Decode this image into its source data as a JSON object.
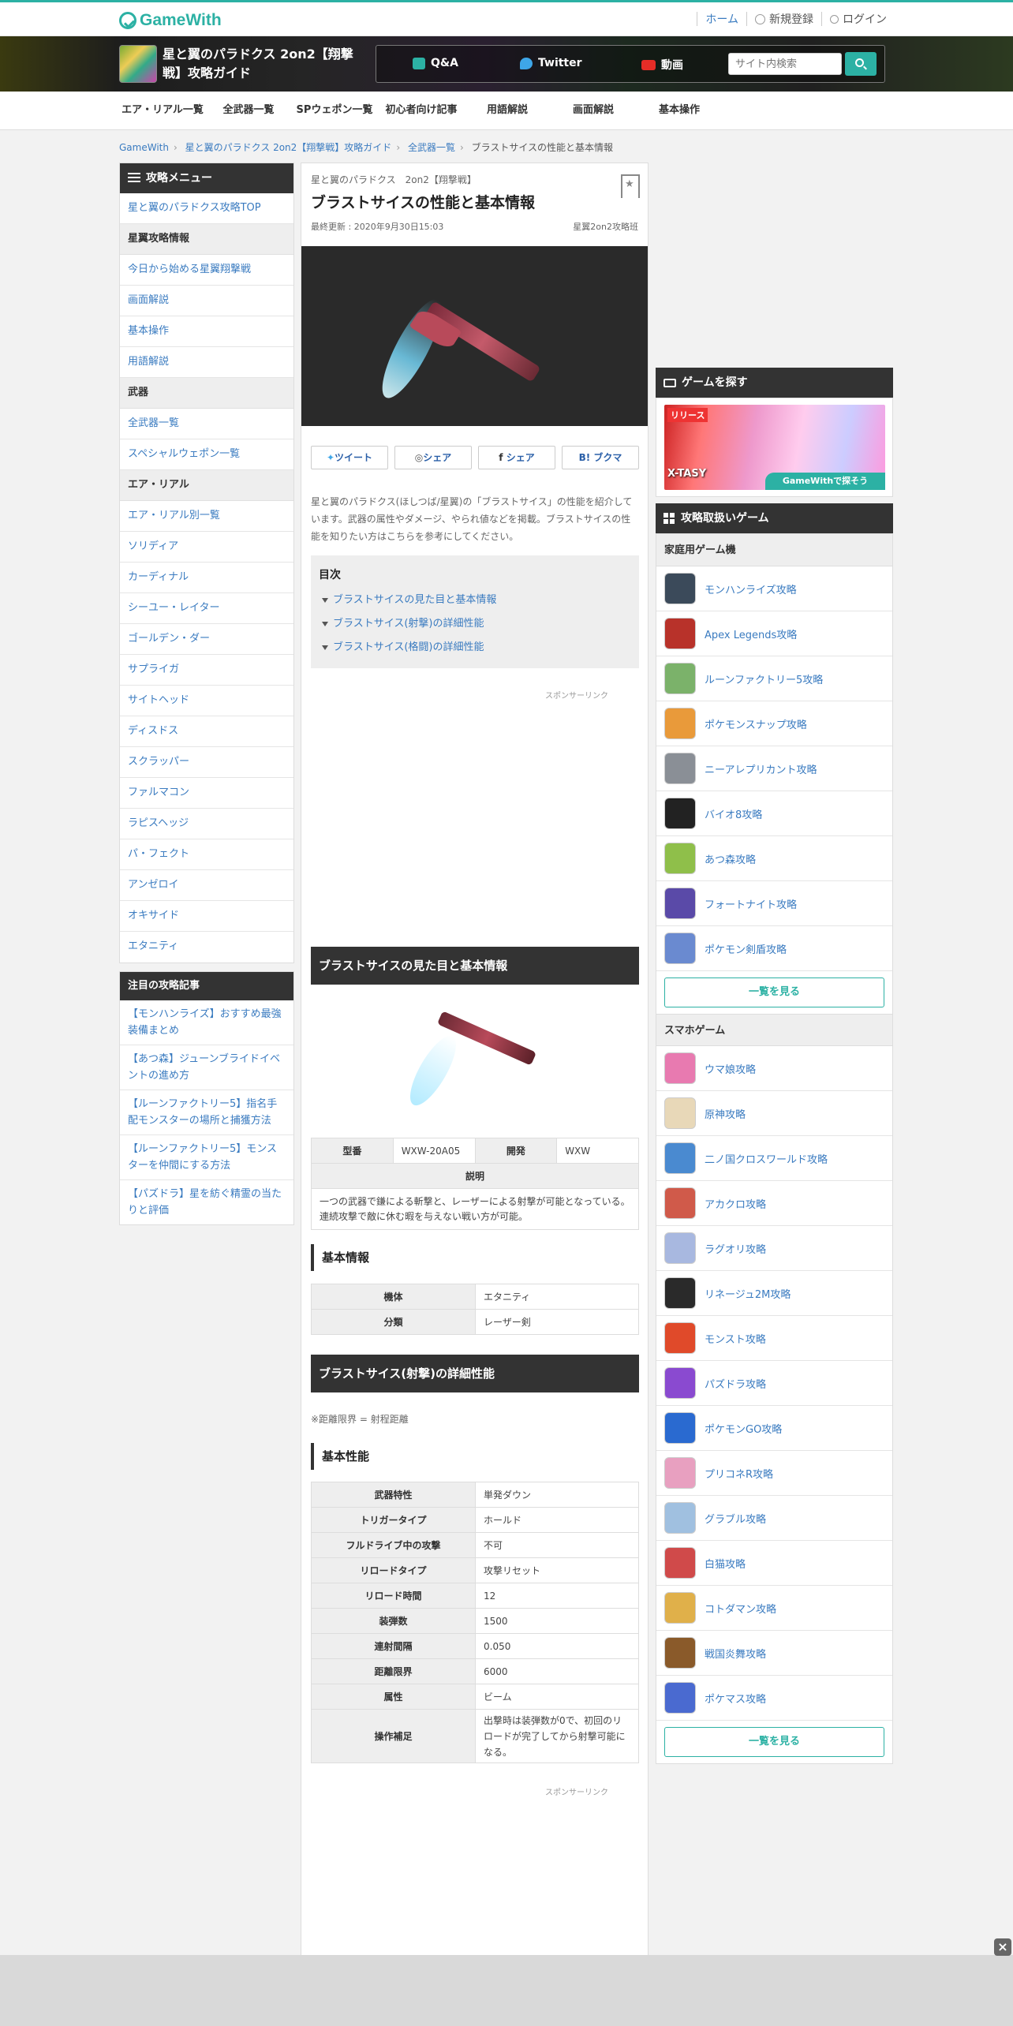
{
  "site": {
    "logo": "GameWith"
  },
  "topnav": {
    "home": "ホーム",
    "register": "新規登録",
    "login": "ログイン"
  },
  "header": {
    "title": "星と翼のパラドクス 2on2【翔撃戦】攻略ガイド",
    "qa": "Q&A",
    "twitter": "Twitter",
    "video": "動画",
    "search_placeholder": "サイト内検索"
  },
  "gnav": [
    "エア・リアル一覧",
    "全武器一覧",
    "SPウェポン一覧",
    "初心者向け記事",
    "用語解説",
    "画面解説",
    "基本操作"
  ],
  "breadcrumb": [
    "GameWith",
    "星と翼のパラドクス 2on2【翔撃戦】攻略ガイド",
    "全武器一覧",
    "ブラストサイスの性能と基本情報"
  ],
  "left_sidebar": {
    "menu_title": "攻略メニュー",
    "top_link": "星と翼のパラドクス攻略TOP",
    "sections": [
      {
        "title": "星翼攻略情報",
        "items": [
          "今日から始める星翼翔撃戦",
          "画面解説",
          "基本操作",
          "用語解説"
        ]
      },
      {
        "title": "武器",
        "items": [
          "全武器一覧",
          "スペシャルウェポン一覧"
        ]
      },
      {
        "title": "エア・リアル",
        "items": [
          "エア・リアル別一覧",
          "ソリディア",
          "カーディナル",
          "シーユー・レイター",
          "ゴールデン・ダー",
          "サプライガ",
          "サイトヘッド",
          "ディスドス",
          "スクラッパー",
          "ファルマコン",
          "ラピスヘッジ",
          "パ・フェクト",
          "アンゼロイ",
          "オキサイド",
          "エタニティ"
        ]
      }
    ],
    "featured_title": "注目の攻略記事",
    "featured": [
      "【モンハンライズ】おすすめ最強装備まとめ",
      "【あつ森】ジューンブライドイベントの進め方",
      "【ルーンファクトリー5】指名手配モンスターの場所と捕獲方法",
      "【ルーンファクトリー5】モンスターを仲間にする方法",
      "【パズドラ】星を紡ぐ精霊の当たりと評価"
    ]
  },
  "article": {
    "game_label": "星と翼のパラドクス　2on2【翔撃戦】",
    "title": "ブラストサイスの性能と基本情報",
    "updated": "最終更新 : 2020年9月30日15:03",
    "author": "星翼2on2攻略班",
    "share": {
      "tweet": "ツイート",
      "line": "シェア",
      "facebook": "シェア",
      "hatena": "ブクマ"
    },
    "intro": "星と翼のパラドクス(ほしつば/星翼)の「ブラストサイス」の性能を紹介しています。武器の属性やダメージ、やられ値などを掲載。ブラストサイスの性能を知りたい方はこちらを参考にしてください。",
    "toc_title": "目次",
    "toc": [
      "ブラストサイスの見た目と基本情報",
      "ブラストサイス(射撃)の詳細性能",
      "ブラストサイス(格闘)の詳細性能"
    ],
    "sponsor": "スポンサーリンク",
    "sec1": "ブラストサイスの見た目と基本情報",
    "spec": {
      "model_label": "型番",
      "model": "WXW-20A05",
      "dev_label": "開発",
      "dev": "WXW",
      "desc_label": "説明",
      "desc": "一つの武器で鎌による斬撃と、レーザーによる射撃が可能となっている。連続攻撃で敵に休む暇を与えない戦い方が可能。"
    },
    "basic_title": "基本情報",
    "basic": [
      {
        "k": "機体",
        "v": "エタニティ"
      },
      {
        "k": "分類",
        "v": "レーザー剣"
      }
    ],
    "sec2": "ブラストサイス(射撃)の詳細性能",
    "note": "※距離限界 = 射程距離",
    "perf_title": "基本性能",
    "perf": [
      {
        "k": "武器特性",
        "v": "単発ダウン"
      },
      {
        "k": "トリガータイプ",
        "v": "ホールド"
      },
      {
        "k": "フルドライブ中の攻撃",
        "v": "不可"
      },
      {
        "k": "リロードタイプ",
        "v": "攻撃リセット"
      },
      {
        "k": "リロード時間",
        "v": "12"
      },
      {
        "k": "装弾数",
        "v": "1500"
      },
      {
        "k": "連射間隔",
        "v": "0.050"
      },
      {
        "k": "距離限界",
        "v": "6000"
      },
      {
        "k": "属性",
        "v": "ビーム"
      },
      {
        "k": "操作補足",
        "v": "出撃時は装弾数が0で、初回のリロードが完了してから射撃可能になる。"
      }
    ]
  },
  "right_sidebar": {
    "find_title": "ゲームを探す",
    "promo_tag": "リリース",
    "promo_title": "X-TASY",
    "promo_badge": "GameWithで探そう",
    "games_title": "攻略取扱いゲーム",
    "console_title": "家庭用ゲーム機",
    "console": [
      {
        "name": "モンハンライズ攻略",
        "color": "#3b4a5a"
      },
      {
        "name": "Apex Legends攻略",
        "color": "#b8322a"
      },
      {
        "name": "ルーンファクトリー5攻略",
        "color": "#7bb26a"
      },
      {
        "name": "ポケモンスナップ攻略",
        "color": "#e99a3a"
      },
      {
        "name": "ニーアレプリカント攻略",
        "color": "#8a8f96"
      },
      {
        "name": "バイオ8攻略",
        "color": "#222222"
      },
      {
        "name": "あつ森攻略",
        "color": "#8fbf4a"
      },
      {
        "name": "フォートナイト攻略",
        "color": "#5a4aa8"
      },
      {
        "name": "ポケモン剣盾攻略",
        "color": "#6a8ad0"
      }
    ],
    "more": "一覧を見る",
    "mobile_title": "スマホゲーム",
    "mobile": [
      {
        "name": "ウマ娘攻略",
        "color": "#e87ab0"
      },
      {
        "name": "原神攻略",
        "color": "#e8d8b8"
      },
      {
        "name": "二ノ国クロスワールド攻略",
        "color": "#4a8ad0"
      },
      {
        "name": "アカクロ攻略",
        "color": "#d05a4a"
      },
      {
        "name": "ラグオリ攻略",
        "color": "#a8b8e0"
      },
      {
        "name": "リネージュ2M攻略",
        "color": "#2a2a2a"
      },
      {
        "name": "モンスト攻略",
        "color": "#e04a2a"
      },
      {
        "name": "パズドラ攻略",
        "color": "#8a4ad0"
      },
      {
        "name": "ポケモンGO攻略",
        "color": "#2a6ad0"
      },
      {
        "name": "プリコネR攻略",
        "color": "#e8a0c0"
      },
      {
        "name": "グラブル攻略",
        "color": "#a0c0e0"
      },
      {
        "name": "白猫攻略",
        "color": "#d04a4a"
      },
      {
        "name": "コトダマン攻略",
        "color": "#e0b04a"
      },
      {
        "name": "戦国炎舞攻略",
        "color": "#8a5a2a"
      },
      {
        "name": "ポケマス攻略",
        "color": "#4a6ad0"
      }
    ]
  },
  "colors": {
    "brand": "#2cb1a4",
    "link": "#3a7bc0",
    "dark": "#333333"
  }
}
